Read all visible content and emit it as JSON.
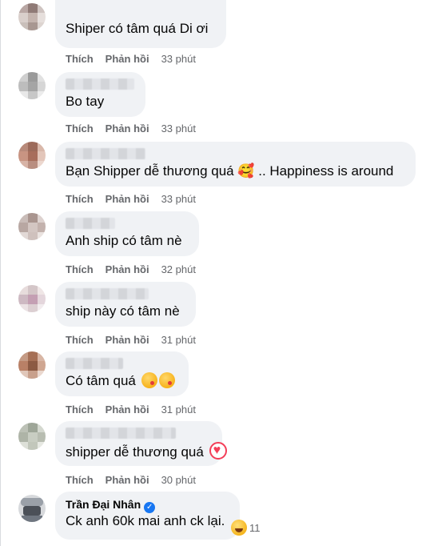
{
  "labels": {
    "like": "Thích",
    "reply": "Phản hồi"
  },
  "comments": [
    {
      "text": "Shiper có tâm quá Di ơi",
      "time": "33 phút"
    },
    {
      "text": "Bo tay",
      "time": "33 phút"
    },
    {
      "text": "Bạn Shipper dễ thương quá 🥰 .. Happiness is around",
      "time": "33 phút"
    },
    {
      "text": "Anh ship có tâm nè",
      "time": "32 phút"
    },
    {
      "text": "ship này có tâm nè",
      "time": "31 phút"
    },
    {
      "text": "Có tâm quá",
      "time": "31 phút"
    },
    {
      "text": "shipper dễ thương quá",
      "time": "30 phút"
    },
    {
      "author": "Trần Đại Nhân",
      "text": "Ck anh 60k mai anh ck lại.",
      "reaction_count": "11"
    }
  ],
  "icons": {
    "verified": "verified-badge-icon",
    "kiss": "kissing-face-emoji-icon",
    "heart": "heart-emoji-icon",
    "laugh": "laughing-face-reaction-icon"
  },
  "colors": {
    "bubble": "#f0f2f5",
    "meta": "#65676b",
    "verified": "#1877f2",
    "heart": "#f33e58"
  }
}
